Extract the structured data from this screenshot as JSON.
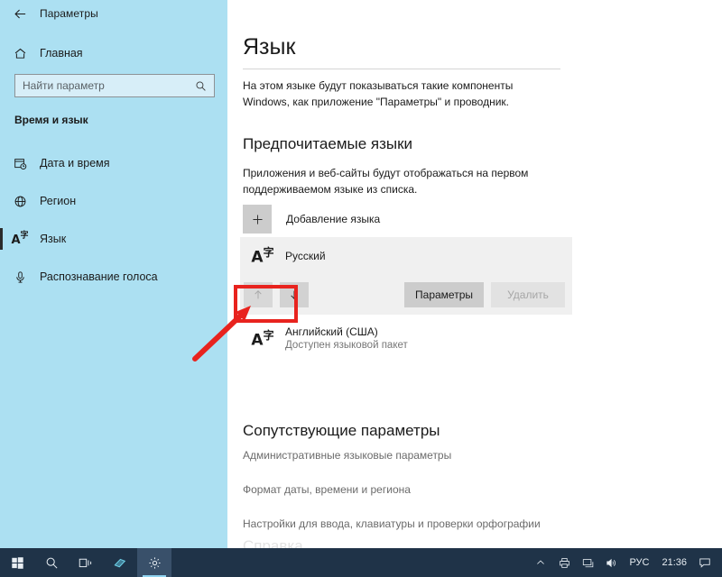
{
  "window": {
    "title": "Параметры",
    "back_icon": "back-arrow-icon",
    "minimize_label": "—",
    "maximize_label": "❐",
    "close_label": "✕"
  },
  "sidebar": {
    "home": {
      "label": "Главная",
      "icon": "home-icon"
    },
    "search": {
      "placeholder": "Найти параметр",
      "value": "",
      "icon": "search-icon"
    },
    "group_title": "Время и язык",
    "items": [
      {
        "label": "Дата и время",
        "icon": "calendar-clock-icon",
        "selected": false
      },
      {
        "label": "Регион",
        "icon": "globe-icon",
        "selected": false
      },
      {
        "label": "Язык",
        "icon": "language-icon",
        "selected": true
      },
      {
        "label": "Распознавание голоса",
        "icon": "microphone-icon",
        "selected": false
      }
    ]
  },
  "content": {
    "page_title": "Язык",
    "page_description": "На этом языке будут показываться такие компоненты Windows, как приложение \"Параметры\" и проводник.",
    "preferred": {
      "heading": "Предпочитаемые языки",
      "description": "Приложения и веб-сайты будут отображаться на первом поддерживаемом языке из списка.",
      "add_label": "Добавление языка",
      "add_icon": "plus-icon",
      "languages": [
        {
          "name": "Русский",
          "subtitle": "",
          "icon": "language-icon",
          "selected": true,
          "actions": {
            "move_up": {
              "label": "move-up",
              "icon": "arrow-up-icon",
              "enabled": false
            },
            "move_down": {
              "label": "move-down",
              "icon": "arrow-down-icon",
              "enabled": true
            },
            "options": {
              "label": "Параметры",
              "enabled": true
            },
            "remove": {
              "label": "Удалить",
              "enabled": false
            }
          }
        },
        {
          "name": "Английский (США)",
          "subtitle": "Доступен языковой пакет",
          "icon": "language-icon",
          "selected": false
        }
      ]
    },
    "related": {
      "heading": "Сопутствующие параметры",
      "links": [
        "Административные языковые параметры",
        "Формат даты, времени и региона",
        "Настройки для ввода, клавиатуры и проверки орфографии"
      ]
    }
  },
  "annotation": {
    "highlight_color": "#e8231e",
    "shape": "rectangle-around-reorder-buttons",
    "arrow": "pointer-arrow-to-move-up-button"
  },
  "taskbar": {
    "buttons": [
      {
        "name": "start-button",
        "icon": "windows-logo-icon",
        "active": false
      },
      {
        "name": "search-button",
        "icon": "search-icon",
        "active": false
      },
      {
        "name": "task-view-button",
        "icon": "task-view-icon",
        "active": false
      },
      {
        "name": "app-button",
        "icon": "app-icon",
        "active": false
      },
      {
        "name": "settings-button",
        "icon": "gear-icon",
        "active": true
      }
    ],
    "tray": {
      "chevron_icon": "chevron-up-icon",
      "icons": [
        "printer-icon",
        "network-icon",
        "volume-icon"
      ],
      "language": "РУС",
      "clock": "21:36",
      "notifications_icon": "notification-icon"
    }
  }
}
